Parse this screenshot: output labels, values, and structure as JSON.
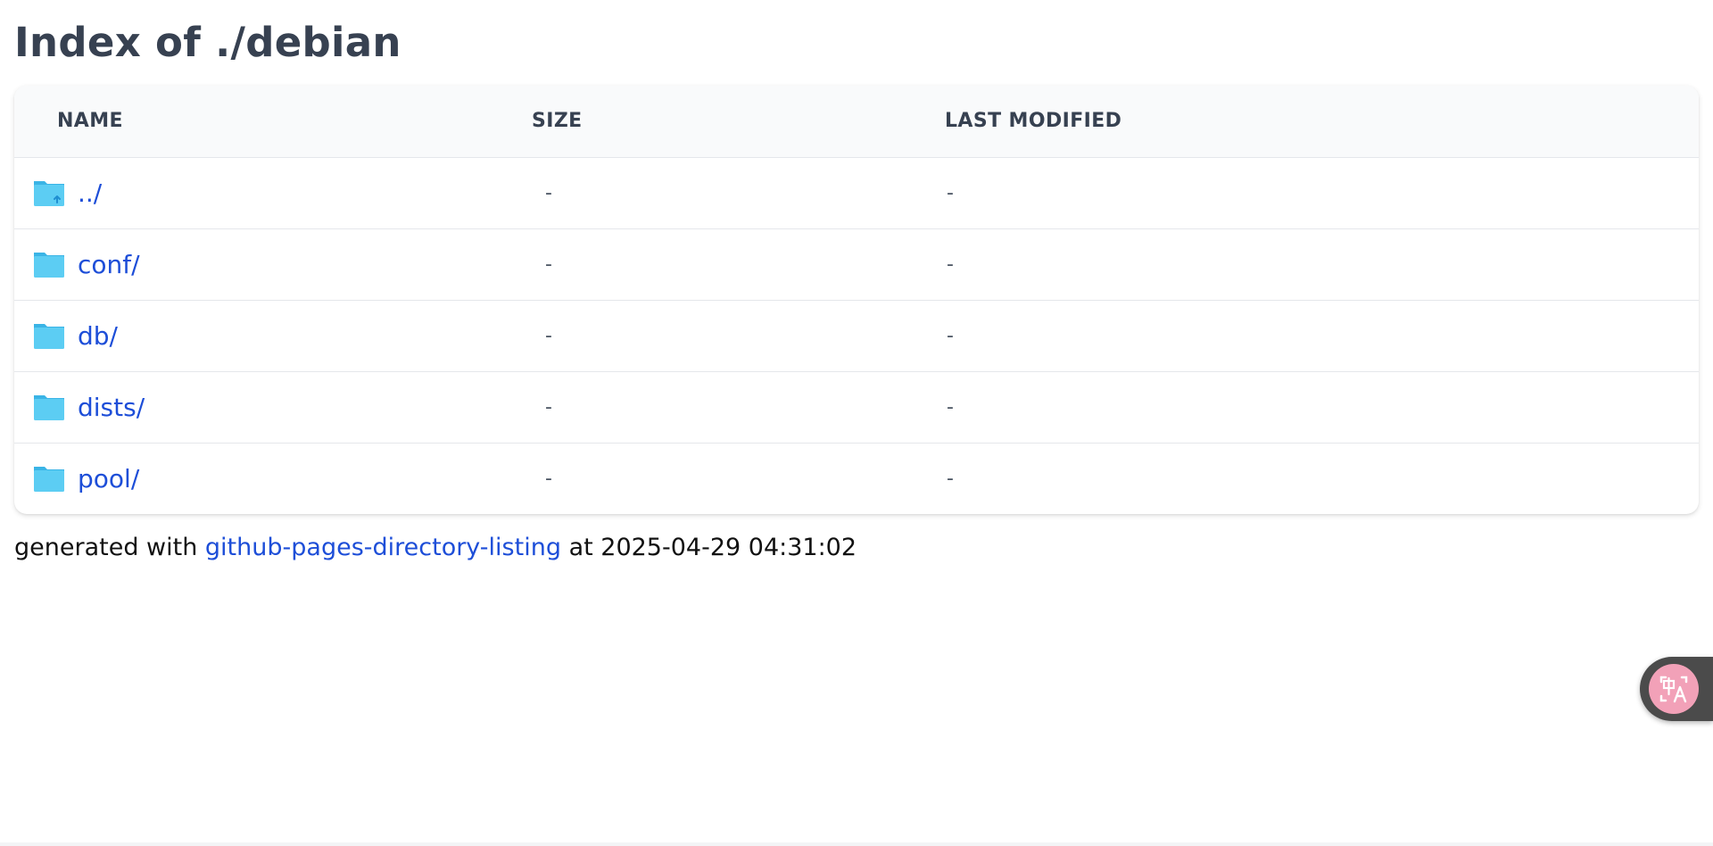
{
  "page": {
    "title": "Index of ./debian"
  },
  "table": {
    "headers": {
      "name": "NAME",
      "size": "SIZE",
      "modified": "LAST MODIFIED"
    },
    "rows": [
      {
        "name": "../",
        "size": "-",
        "modified": "-",
        "icon": "folder-up-icon"
      },
      {
        "name": "conf/",
        "size": "-",
        "modified": "-",
        "icon": "folder-icon"
      },
      {
        "name": "db/",
        "size": "-",
        "modified": "-",
        "icon": "folder-icon"
      },
      {
        "name": "dists/",
        "size": "-",
        "modified": "-",
        "icon": "folder-icon"
      },
      {
        "name": "pool/",
        "size": "-",
        "modified": "-",
        "icon": "folder-icon"
      }
    ]
  },
  "footer": {
    "prefix": "generated with",
    "link_text": "github-pages-directory-listing",
    "suffix": "at 2025-04-29 04:31:02"
  },
  "widgets": {
    "translate_icon": "translate-icon"
  },
  "colors": {
    "link": "#1d4ed8",
    "heading": "#374151",
    "folder": "#5ccdf3",
    "folder_tab": "#3ab4e6",
    "header_bg": "#f9fafb",
    "translate_badge": "#f2a1b8"
  }
}
